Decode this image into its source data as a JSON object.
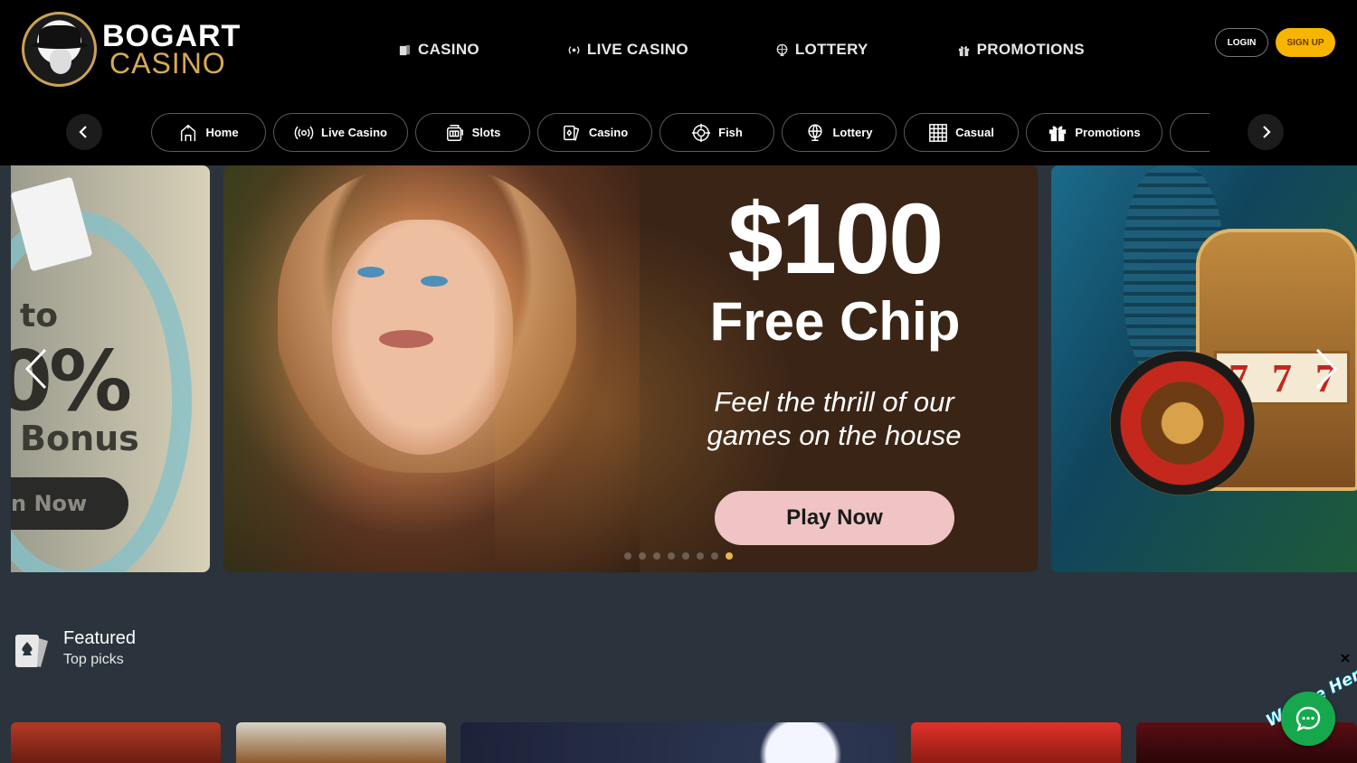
{
  "header": {
    "logo": {
      "title": "BOGART",
      "subtitle": "CASINO"
    },
    "nav": [
      {
        "label": "CASINO",
        "icon": "card-icon"
      },
      {
        "label": "LIVE CASINO",
        "icon": "broadcast-icon"
      },
      {
        "label": "LOTTERY",
        "icon": "globe-icon"
      },
      {
        "label": "PROMOTIONS",
        "icon": "gift-icon"
      }
    ],
    "login_label": "LOGIN",
    "signup_label": "SIGN UP"
  },
  "categories": [
    {
      "label": "Home",
      "icon": "home-icon"
    },
    {
      "label": "Live Casino",
      "icon": "broadcast-icon"
    },
    {
      "label": "Slots",
      "icon": "slot-machine-icon"
    },
    {
      "label": "Casino",
      "icon": "card-icon"
    },
    {
      "label": "Fish",
      "icon": "crosshair-icon"
    },
    {
      "label": "Lottery",
      "icon": "globe-icon"
    },
    {
      "label": "Casual",
      "icon": "grid-icon"
    },
    {
      "label": "Promotions",
      "icon": "gift-icon"
    }
  ],
  "hero": {
    "left_slide": {
      "line1": "to",
      "line2": "0%",
      "line3": "Bonus",
      "cta": "n Now"
    },
    "main_slide": {
      "amount": "$100",
      "amount_sub": "Free Chip",
      "tagline_line1": "Feel the thrill of our",
      "tagline_line2": "games on the house",
      "cta": "Play Now"
    },
    "slide_count": 8,
    "active_slide": 8
  },
  "featured": {
    "title": "Featured",
    "subtitle": "Top picks"
  },
  "chat": {
    "badge_text": "We Are Here!",
    "close_label": "×"
  },
  "colors": {
    "background": "#2b343c",
    "header": "#000000",
    "signup": "#f7b500",
    "logo_gold": "#d7a955",
    "play_button": "#f0c4c4",
    "chat": "#17a84e"
  }
}
